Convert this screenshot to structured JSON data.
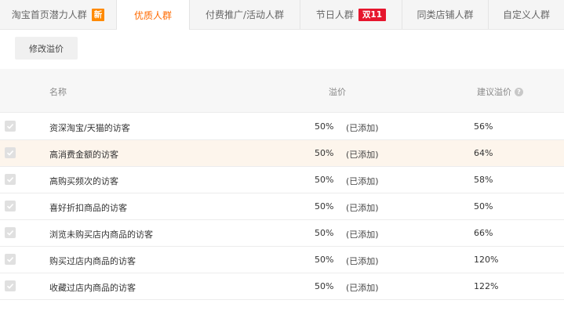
{
  "tabs": [
    {
      "label": "淘宝首页潜力人群",
      "badge": "新"
    },
    {
      "label": "优质人群",
      "active": true
    },
    {
      "label": "付费推广/活动人群"
    },
    {
      "label": "节日人群",
      "badge": "双11"
    },
    {
      "label": "同类店铺人群"
    },
    {
      "label": "自定义人群"
    }
  ],
  "toolbar": {
    "modify_label": "修改溢价"
  },
  "table": {
    "headers": {
      "name": "名称",
      "premium": "溢价",
      "suggest": "建议溢价"
    },
    "rows": [
      {
        "name": "资深淘宝/天猫的访客",
        "premium": "50%",
        "status": "(已添加)",
        "suggest": "56%",
        "checked": true
      },
      {
        "name": "高消费金额的访客",
        "premium": "50%",
        "status": "(已添加)",
        "suggest": "64%",
        "checked": true
      },
      {
        "name": "高购买频次的访客",
        "premium": "50%",
        "status": "(已添加)",
        "suggest": "58%",
        "checked": true
      },
      {
        "name": "喜好折扣商品的访客",
        "premium": "50%",
        "status": "(已添加)",
        "suggest": "50%",
        "checked": true
      },
      {
        "name": "浏览未购买店内商品的访客",
        "premium": "50%",
        "status": "(已添加)",
        "suggest": "66%",
        "checked": true
      },
      {
        "name": "购买过店内商品的访客",
        "premium": "50%",
        "status": "(已添加)",
        "suggest": "120%",
        "checked": true
      },
      {
        "name": "收藏过店内商品的访客",
        "premium": "50%",
        "status": "(已添加)",
        "suggest": "122%",
        "checked": true
      }
    ]
  },
  "colors": {
    "accent": "#ff6a00",
    "new_badge": "#ff8a00",
    "d11_badge": "#e6162d",
    "row_highlight": "#fdf5ec"
  },
  "icons": {
    "suggest_help": "question-circle-icon",
    "row_check": "checkmark-icon"
  }
}
